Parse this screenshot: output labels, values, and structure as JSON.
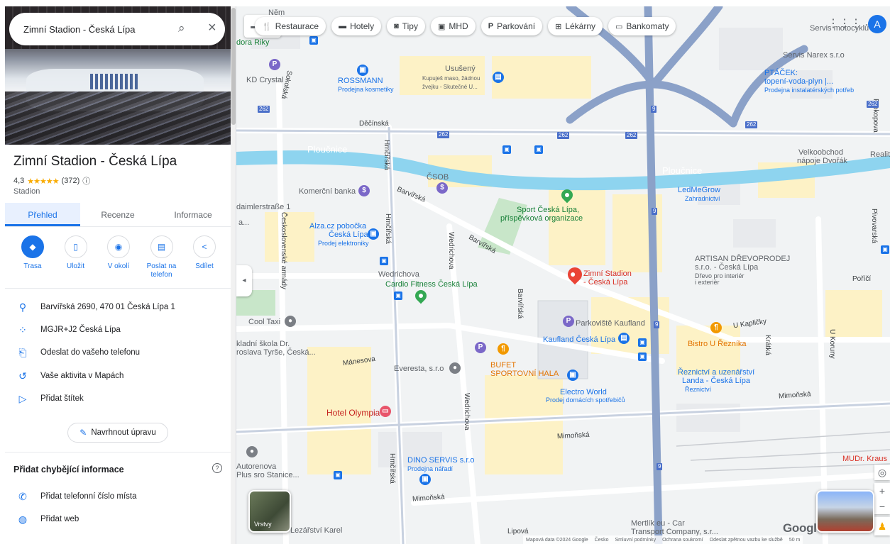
{
  "search": {
    "value": "Zimní Stadion - Česká Lípa"
  },
  "place": {
    "name": "Zimní Stadion - Česká Lípa",
    "rating": "4,3",
    "stars": "★★★★★",
    "reviews": "(372)",
    "category": "Stadion"
  },
  "tabs": [
    "Přehled",
    "Recenze",
    "Informace"
  ],
  "actions": [
    {
      "label": "Trasa",
      "icon": "directions-icon"
    },
    {
      "label": "Uložit",
      "icon": "bookmark-icon"
    },
    {
      "label": "V okolí",
      "icon": "nearby-icon"
    },
    {
      "label": "Poslat na telefon",
      "icon": "send-to-phone-icon"
    },
    {
      "label": "Sdílet",
      "icon": "share-icon"
    }
  ],
  "info_rows": [
    {
      "icon": "location-pin-icon",
      "text": "Barvířská 2690, 470 01 Česká Lípa 1"
    },
    {
      "icon": "plus-code-icon",
      "text": "MGJR+J2 Česká Lípa"
    },
    {
      "icon": "phone-send-icon",
      "text": "Odeslat do vašeho telefonu"
    },
    {
      "icon": "history-icon",
      "text": "Vaše aktivita v Mapách"
    },
    {
      "icon": "label-icon",
      "text": "Přidat štítek"
    }
  ],
  "suggest_edit": "Navrhnout úpravu",
  "missing": {
    "title": "Přidat chybějící informace",
    "rows": [
      {
        "icon": "phone-icon",
        "text": "Přidat telefonní číslo místa"
      },
      {
        "icon": "globe-icon",
        "text": "Přidat web"
      }
    ]
  },
  "chips": [
    {
      "icon": "restaurant-icon",
      "label": "Restaurace"
    },
    {
      "icon": "hotel-icon",
      "label": "Hotely"
    },
    {
      "icon": "camera-icon",
      "label": "Tipy"
    },
    {
      "icon": "transit-icon",
      "label": "MHD"
    },
    {
      "icon": "parking-icon",
      "label": "Parkování"
    },
    {
      "icon": "pharmacy-icon",
      "label": "Lékárny"
    },
    {
      "icon": "atm-icon",
      "label": "Bankomaty"
    }
  ],
  "account_initial": "A",
  "layers_label": "Vrstvy",
  "map_labels": {
    "ploucnice": "Ploučnice",
    "decinska": "Děčínská",
    "hrncirska": "Hrnčířská",
    "barvirska": "Barvířská",
    "wedrichova": "Wedrichova",
    "manesova": "Mánesova",
    "mimonska": "Mimoňská",
    "lipova": "Lipová",
    "u_kaplicky": "U Kapličky",
    "porici": "Poříčí",
    "sokolska": "Sokolská",
    "ceskoslovenske_armady": "Československé armády",
    "kratka": "Krátká",
    "u_koruny": "U Koruny",
    "pivovarska": "Pivovarská",
    "prokopova": "Prokopova",
    "ceska": "Česká",
    "nem": "Něm",
    "dora_riky": "dora Riky",
    "kd_crystal": "KD Crystal",
    "rossmann": "ROSSMANN",
    "rossmann_sub": "Prodejna kosmetiky",
    "ususeny": "Usušený",
    "ususeny_sub": "Kupuješ maso, žádnou žvejku - Skutečné U...",
    "servis_moto": "Servis motocyklů",
    "servis_narex": "Servis Narex s.r.o",
    "ptacek": "PTÁČEK:",
    "ptacek2": "topení-voda-plyn |...",
    "ptacek_sub": "Prodejna instalatérských potřeb",
    "velkoobchod": "Velkoobchod",
    "velkoobchod2": "nápoje Dvořák",
    "realit": "Realit",
    "csob": "ČSOB",
    "komercni": "Komerční banka",
    "daimlerstrasse": "daimlerstraße 1",
    "sport": "Sport Česká Lípa,",
    "sport2": "příspěvková organizace",
    "ledmegrow": "LedMeGrow",
    "ledmegrow_sub": "Zahradnictví",
    "alza": "Alza.cz pobočka",
    "alza2": "Česká Lípa",
    "alza_sub": "Prodej elektroniky",
    "artisan": "ARTISAN DŘEVOPRODEJ",
    "artisan2": "s.r.o. - Česká Lípa",
    "artisan_sub": "Dřevo pro interiér",
    "artisan_sub2": "i exteriér",
    "cardio_pre": "Wedrichova",
    "cardio": "Cardio Fitness Česká Lípa",
    "zimni": "Zimní Stadion",
    "zimni2": "- Česká Lípa",
    "cool_taxi": "Cool Taxi",
    "parkoviste": "Parkoviště Kaufland",
    "kaufland": "Kaufland Česká Lípa",
    "bistro": "Bistro U Řezníka",
    "zakladni": "kladní škola Dr.",
    "zakladni2": "roslava Tyrše, Česká...",
    "everesta": "Everesta, s.r.o",
    "bufet": "BUFET",
    "bufet2": "SPORTOVNÍ HALA",
    "reznictvi": "Řeznictví a uzenářství",
    "reznictvi2": "Landa - Česká Lípa",
    "reznictvi_sub": "Řeznictví",
    "electro": "Electro World",
    "electro_sub": "Prodej domácích spotřebičů",
    "hotel": "Hotel Olympia",
    "dino": "DINO SERVIS s.r.o",
    "dino_sub": "Prodejna nářadí",
    "autorenova": "Autorenova",
    "autorenova2": "Plus sro Stanice...",
    "mudr": "MUDr. Kraus",
    "mertlik": "Mertlík eu - Car",
    "mertlik2": "Transport Company, s.r...",
    "lezarstvi": "Lezářství Karel",
    "a_label": "a..."
  },
  "road_numbers": [
    "262",
    "262",
    "262",
    "262",
    "262",
    "262",
    "262",
    "9",
    "9",
    "9",
    "9",
    "9"
  ],
  "google_logo": "Google",
  "footer": [
    "Mapová data ©2024 Google",
    "Česko",
    "Smluvní podmínky",
    "Ochrana soukromí",
    "Odeslat zpětnou vazbu ke službě",
    "50 m"
  ],
  "colors": {
    "accent": "#1a73e8",
    "river": "#8ed4ef",
    "highway": "#8ba1c8",
    "pin_red": "#ea4335"
  }
}
